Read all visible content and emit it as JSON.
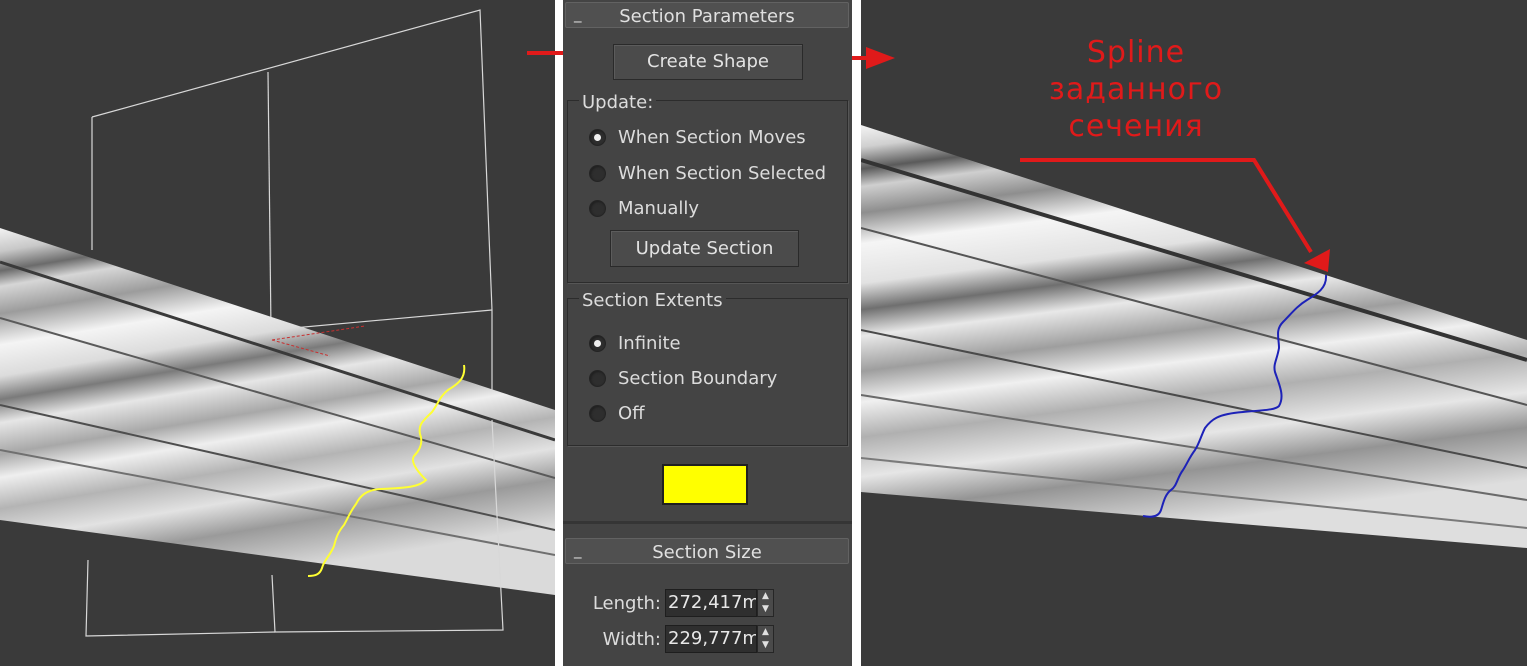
{
  "panel": {
    "section_parameters": {
      "title": "Section Parameters",
      "collapse_symbol": "_",
      "create_shape_label": "Create Shape"
    },
    "update_group": {
      "title": "Update:",
      "options": [
        {
          "label": "When Section Moves",
          "checked": true
        },
        {
          "label": "When Section Selected",
          "checked": false
        },
        {
          "label": "Manually",
          "checked": false
        }
      ],
      "update_button_label": "Update Section"
    },
    "extents_group": {
      "title": "Section Extents",
      "options": [
        {
          "label": "Infinite",
          "checked": true
        },
        {
          "label": "Section Boundary",
          "checked": false
        },
        {
          "label": "Off",
          "checked": false
        }
      ]
    },
    "section_color": "#ffff00",
    "section_size": {
      "title": "Section Size",
      "collapse_symbol": "_",
      "length_label": "Length:",
      "length_value": "272,417m",
      "width_label": "Width:",
      "width_value": "229,777m"
    }
  },
  "annotation": {
    "line1": "Spline",
    "line2": "заданного",
    "line3": "сечения"
  },
  "colors": {
    "annotation_red": "#e01a1a",
    "section_yellow": "#ffff33",
    "spline_blue": "#1d22b8",
    "viewport_bg": "#3a3a3a"
  }
}
